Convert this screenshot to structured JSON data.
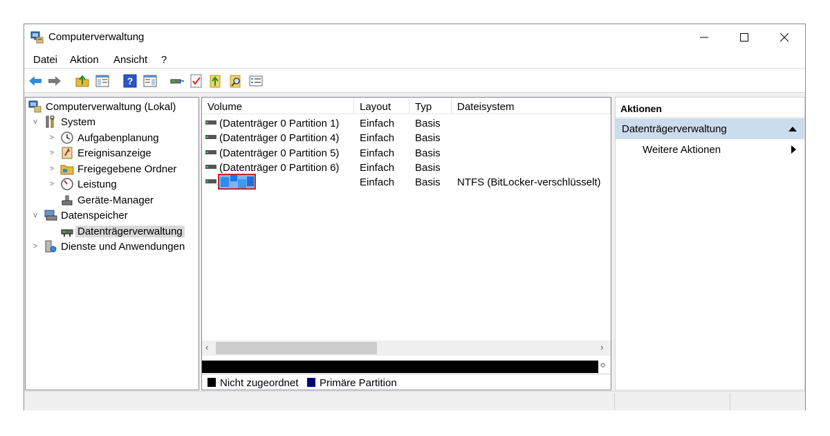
{
  "window": {
    "title": "Computerverwaltung"
  },
  "menu": [
    "Datei",
    "Aktion",
    "Ansicht",
    "?"
  ],
  "tree": {
    "items": [
      {
        "label": "Computerverwaltung (Lokal)",
        "icon": "computer-management-icon"
      },
      {
        "label": "System",
        "icon": "tools-icon",
        "expander": "v"
      },
      {
        "label": "Aufgabenplanung",
        "icon": "clock-icon",
        "expander": ">"
      },
      {
        "label": "Ereignisanzeige",
        "icon": "event-viewer-icon",
        "expander": ">"
      },
      {
        "label": "Freigegebene Ordner",
        "icon": "shared-folder-icon",
        "expander": ">"
      },
      {
        "label": "Leistung",
        "icon": "performance-icon",
        "expander": ">"
      },
      {
        "label": "Geräte-Manager",
        "icon": "device-manager-icon"
      },
      {
        "label": "Datenspeicher",
        "icon": "storage-icon",
        "expander": "v"
      },
      {
        "label": "Datenträgerverwaltung",
        "icon": "disk-management-icon",
        "selected": true
      },
      {
        "label": "Dienste und Anwendungen",
        "icon": "services-icon",
        "expander": ">"
      }
    ]
  },
  "table": {
    "columns": [
      "Volume",
      "Layout",
      "Typ",
      "Dateisystem"
    ],
    "rows": [
      {
        "volume": "(Datenträger 0 Partition 1)",
        "layout": "Einfach",
        "typ": "Basis",
        "dateisystem": ""
      },
      {
        "volume": "(Datenträger 0 Partition 4)",
        "layout": "Einfach",
        "typ": "Basis",
        "dateisystem": ""
      },
      {
        "volume": "(Datenträger 0 Partition 5)",
        "layout": "Einfach",
        "typ": "Basis",
        "dateisystem": ""
      },
      {
        "volume": "(Datenträger 0 Partition 6)",
        "layout": "Einfach",
        "typ": "Basis",
        "dateisystem": ""
      },
      {
        "volume": "",
        "layout": "Einfach",
        "typ": "Basis",
        "dateisystem": "NTFS (BitLocker-verschlüsselt)",
        "redacted": true
      }
    ]
  },
  "legend": {
    "unallocated": {
      "label": "Nicht zugeordnet",
      "color": "#000000"
    },
    "primary": {
      "label": "Primäre Partition",
      "color": "#000080"
    }
  },
  "actions": {
    "header": "Aktionen",
    "group": "Datenträgerverwaltung",
    "item": "Weitere Aktionen"
  },
  "colors": {
    "selection": "#cbdcec",
    "redaction_border": "#c0282d",
    "redaction_blue": "#2e8ef0"
  }
}
